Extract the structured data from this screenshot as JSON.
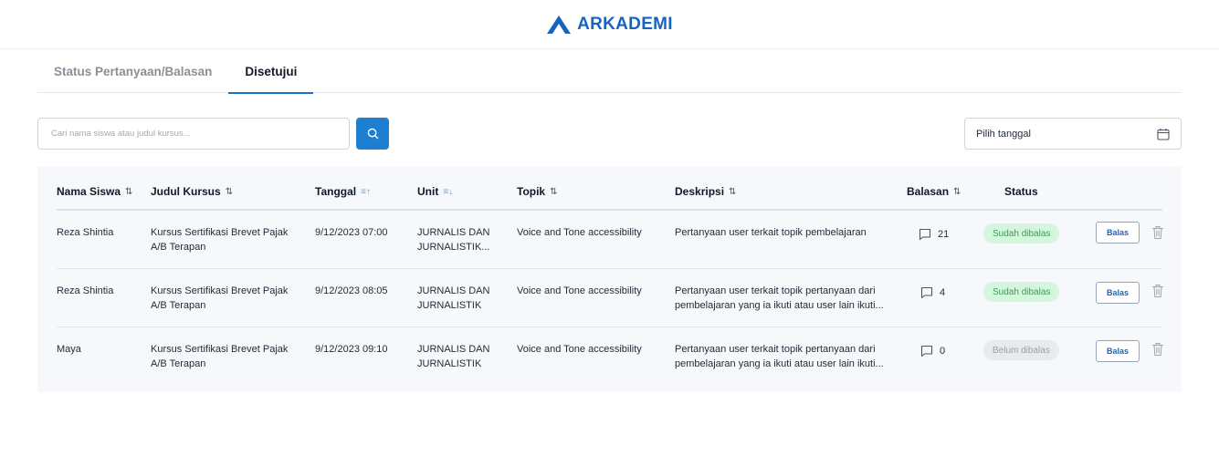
{
  "brand": {
    "name": "ARKADEMI",
    "color": "#1565c0"
  },
  "tabs": [
    {
      "label": "Status Pertanyaan/Balasan",
      "active": false
    },
    {
      "label": "Disetujui",
      "active": true
    }
  ],
  "search": {
    "placeholder": "Cari nama siswa atau judul kursus...",
    "button_icon": "search-icon"
  },
  "date_filter": {
    "label": "Pilih tanggal",
    "icon": "calendar-icon"
  },
  "table": {
    "columns": [
      {
        "label": "Nama Siswa",
        "sort": "⇅"
      },
      {
        "label": "Judul Kursus",
        "sort": "⇅"
      },
      {
        "label": "Tanggal",
        "sort": "≡↑"
      },
      {
        "label": "Unit",
        "sort": "≡↓"
      },
      {
        "label": "Topik",
        "sort": "⇅"
      },
      {
        "label": "Deskripsi",
        "sort": "⇅"
      },
      {
        "label": "Balasan",
        "sort": "⇅"
      },
      {
        "label": "Status",
        "sort": ""
      }
    ],
    "rows": [
      {
        "name": "Reza Shintia",
        "course_1": "Kursus Sertifikasi Brevet Pajak",
        "course_2": "A/B Terapan",
        "date": "9/12/2023 07:00",
        "unit_1": "JURNALIS DAN",
        "unit_2": "JURNALISTIK...",
        "topic": "Voice and Tone accessibility",
        "desc_1": "Pertanyaan user terkait topik pembelajaran",
        "desc_2": "",
        "replies": "21",
        "status": "Sudah dibalas",
        "action": "Balas"
      },
      {
        "name": "Reza Shintia",
        "course_1": "Kursus Sertifikasi Brevet Pajak",
        "course_2": "A/B Terapan",
        "date": "9/12/2023 08:05",
        "unit_1": "JURNALIS DAN",
        "unit_2": "JURNALISTIK",
        "topic": "Voice and Tone accessibility",
        "desc_1": "Pertanyaan user terkait topik pertanyaan dari",
        "desc_2": "pembelajaran yang ia ikuti atau user lain ikuti...",
        "replies": "4",
        "status": "Sudah dibalas",
        "action": "Balas"
      },
      {
        "name": "Maya",
        "course_1": "Kursus Sertifikasi Brevet Pajak",
        "course_2": "A/B Terapan",
        "date": "9/12/2023 09:10",
        "unit_1": "JURNALIS DAN",
        "unit_2": "JURNALISTIK",
        "topic": "Voice and Tone accessibility",
        "desc_1": "Pertanyaan user terkait topik pertanyaan dari",
        "desc_2": "pembelajaran yang ia ikuti atau user lain ikuti...",
        "replies": "0",
        "status": "Belum dibalas",
        "action": "Balas"
      }
    ]
  },
  "colors": {
    "primary": "#1e7fd1",
    "status_done_bg": "#d6f5dd",
    "status_done_text": "#3a9c55",
    "status_pending_bg": "#e9eaec",
    "status_pending_text": "#9aa0a6"
  }
}
